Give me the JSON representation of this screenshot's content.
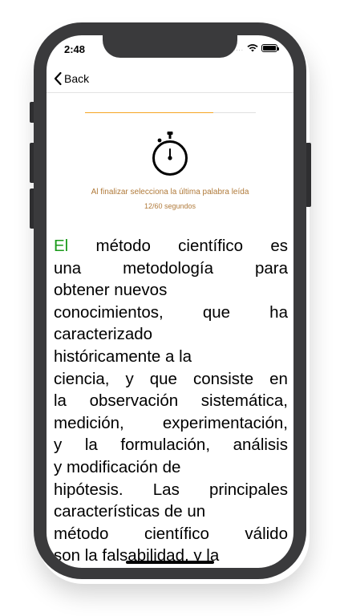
{
  "status_bar": {
    "time": "2:48",
    "signal": "....",
    "icons": [
      "wifi-icon",
      "battery-icon"
    ]
  },
  "nav": {
    "back_label": "Back",
    "back_icon": "chevron-left-icon"
  },
  "progress": {
    "fraction": 0.75,
    "color": "#f5a623"
  },
  "timer": {
    "icon": "stopwatch-icon",
    "instruction": "Al finalizar selecciona la última palabra leída",
    "elapsed_text": "12/60 segundos"
  },
  "reading": {
    "highlight_color": "#1a9a1a",
    "first_word": "El",
    "lines": [
      "método científico es",
      "una metodología para",
      "obtener nuevos",
      "conocimientos, que ha",
      "caracterizado",
      "históricamente a la",
      "ciencia, y que consiste en",
      "la observación sistemática,",
      "medición, experimentación,",
      "y la formulación, análisis",
      "y modificación de",
      "hipótesis. Las principales",
      "características de un",
      "método científico válido",
      "son la falsabilidad, y la"
    ]
  }
}
